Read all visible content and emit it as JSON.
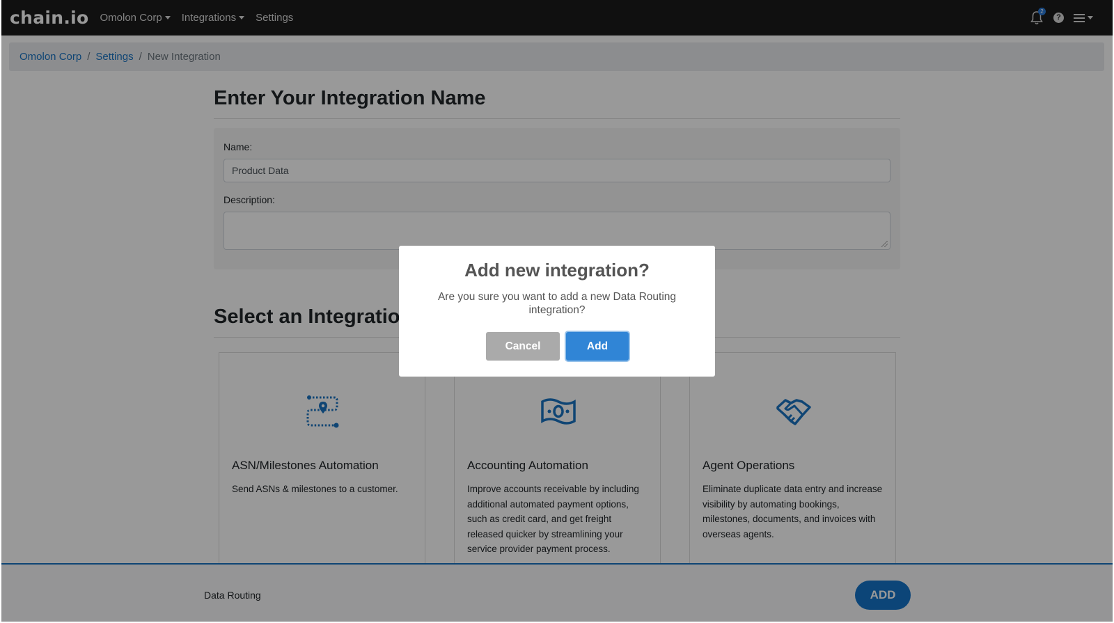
{
  "nav": {
    "logo": "chain.io",
    "org_menu": "Omolon Corp",
    "integrations_menu": "Integrations",
    "settings_link": "Settings",
    "notification_count": "2",
    "help_glyph": "?"
  },
  "breadcrumb": {
    "root": "Omolon Corp",
    "settings": "Settings",
    "current": "New Integration"
  },
  "form": {
    "heading": "Enter Your Integration Name",
    "name_label": "Name:",
    "name_value": "Product Data",
    "description_label": "Description:",
    "description_value": ""
  },
  "select_heading": "Select an Integration Type",
  "cards": [
    {
      "title": "ASN/Milestones Automation",
      "description": "Send ASNs & milestones to a customer.",
      "icon": "route-pin-icon"
    },
    {
      "title": "Accounting Automation",
      "description": "Improve accounts receivable by including additional automated payment options, such as credit card, and get freight released quicker by streamlining your service provider payment process.",
      "icon": "money-bill-icon"
    },
    {
      "title": "Agent Operations",
      "description": "Eliminate duplicate data entry and increase visibility by automating bookings, milestones, documents, and invoices with overseas agents.",
      "icon": "handshake-icon"
    }
  ],
  "footer": {
    "selected_label": "Data Routing",
    "add_button": "ADD"
  },
  "modal": {
    "title": "Add new integration?",
    "text": "Are you sure you want to add a new Data Routing integration?",
    "cancel": "Cancel",
    "confirm": "Add"
  },
  "colors": {
    "navbar": "#1b1b1b",
    "link": "#1a73c2",
    "primary": "#3085d6",
    "footer_button": "#1473c8",
    "cancel": "#aaaaaa"
  }
}
